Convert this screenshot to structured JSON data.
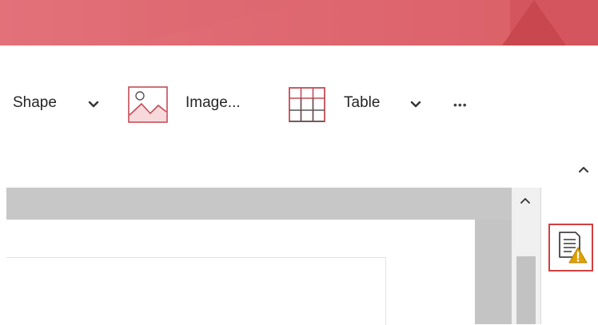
{
  "ribbon": {
    "shape_label": "Shape",
    "image_label": "Image...",
    "table_label": "Table",
    "more_label": "•••"
  },
  "colors": {
    "titlebar": "#db5f67",
    "accent_red": "#d0403f",
    "warning": "#e0a200"
  },
  "icons": {
    "shape_dropdown": "chevron-down-icon",
    "image": "image-icon",
    "table": "table-icon",
    "table_dropdown": "chevron-down-icon",
    "more": "more-icon",
    "collapse_ribbon": "chevron-up-icon",
    "scroll_up": "chevron-up-icon",
    "accessibility": "accessibility-checker-warning-icon"
  }
}
